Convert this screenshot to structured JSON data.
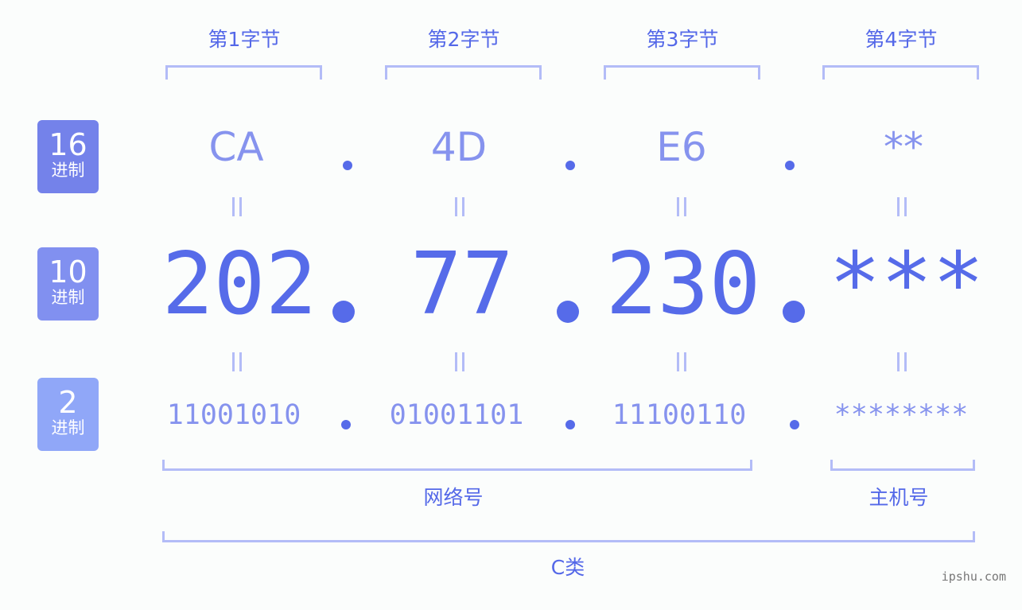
{
  "bytes": [
    {
      "label": "第1字节",
      "hex": "CA",
      "dec": "202",
      "bin": "11001010"
    },
    {
      "label": "第2字节",
      "hex": "4D",
      "dec": "77",
      "bin": "01001101"
    },
    {
      "label": "第3字节",
      "hex": "E6",
      "dec": "230",
      "bin": "11100110"
    },
    {
      "label": "第4字节",
      "hex": "**",
      "dec": "***",
      "bin": "********"
    }
  ],
  "rows": [
    {
      "num": "16",
      "text": "进制",
      "color": "#7482ea"
    },
    {
      "num": "10",
      "text": "进制",
      "color": "#8190f0"
    },
    {
      "num": "2",
      "text": "进制",
      "color": "#90a7f8"
    }
  ],
  "groups": {
    "network": "网络号",
    "host": "主机号",
    "class": "C类"
  },
  "watermark": "ipshu.com",
  "colors": {
    "accent": "#566be9",
    "light": "#8693ee",
    "bracket": "#b3bcf7"
  }
}
